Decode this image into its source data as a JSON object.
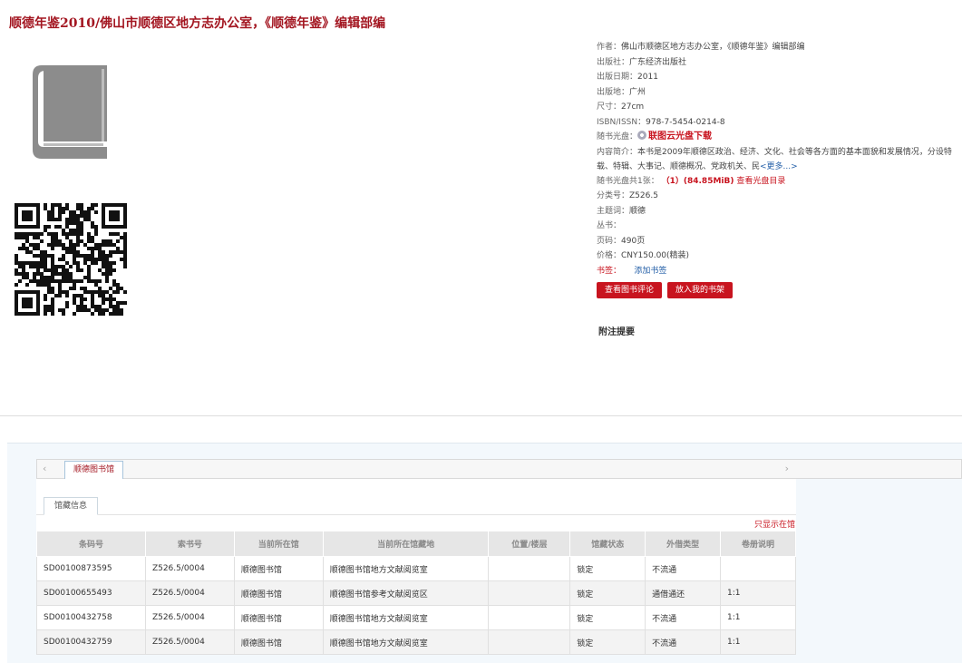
{
  "title": "顺德年鉴2010/佛山市顺德区地方志办公室，《顺德年鉴》编辑部编",
  "meta": {
    "author_label": "作者：",
    "author": "佛山市顺德区地方志办公室，《顺德年鉴》编辑部编",
    "publisher_label": "出版社：",
    "publisher": "广东经济出版社",
    "pub_date_label": "出版日期：",
    "pub_date": "2011",
    "pub_place_label": "出版地：",
    "pub_place": "广州",
    "size_label": "尺寸：",
    "size": "27cm",
    "isbn_label": "ISBN/ISSN：",
    "isbn": "978-7-5454-0214-8",
    "disc_label": "随书光盘：",
    "disc_link": "联图云光盘下载",
    "summary_label": "内容简介：",
    "summary": "本书是2009年顺德区政治、经济、文化、社会等各方面的基本面貌和发展情况，分设特载、特辑、大事记、顺德概况、党政机关、民",
    "summary_more": "<更多...>",
    "disc_count_label": "随书光盘共1张：",
    "disc_count": "（1）(84.85MiB)",
    "disc_catalog": "查看光盘目录",
    "class_label": "分类号：",
    "class_no": "Z526.5",
    "subject_label": "主题词：",
    "subject": "顺德",
    "series_label": "丛书：",
    "pages_label": "页码：",
    "pages": "490页",
    "price_label": "价格：",
    "price": "CNY150.00(精装)",
    "tags_label": "书签：",
    "add_tag": "添加书签"
  },
  "buttons": {
    "review": "查看图书评论",
    "shelf": "放入我的书架"
  },
  "note_title": "附注提要",
  "tabs": {
    "library": "顺德图书馆",
    "holdings": "馆藏信息",
    "only_onshelf": "只显示在馆"
  },
  "table": {
    "headers": [
      "条码号",
      "索书号",
      "当前所在馆",
      "当前所在馆藏地",
      "位置/楼层",
      "馆藏状态",
      "外借类型",
      "卷册说明"
    ],
    "rows": [
      [
        "SD00100873595",
        "Z526.5/0004",
        "顺德图书馆",
        "顺德图书馆地方文献阅览室",
        "",
        "锁定",
        "不流通",
        ""
      ],
      [
        "SD00100655493",
        "Z526.5/0004",
        "顺德图书馆",
        "顺德图书馆参考文献阅览区",
        "",
        "锁定",
        "通借通还",
        "1:1"
      ],
      [
        "SD00100432758",
        "Z526.5/0004",
        "顺德图书馆",
        "顺德图书馆地方文献阅览室",
        "",
        "锁定",
        "不流通",
        "1:1"
      ],
      [
        "SD00100432759",
        "Z526.5/0004",
        "顺德图书馆",
        "顺德图书馆地方文献阅览室",
        "",
        "锁定",
        "不流通",
        "1:1"
      ]
    ]
  },
  "colors": {
    "accent_red": "#c8141f",
    "title_red": "#a31621",
    "link_blue": "#2560a8"
  }
}
